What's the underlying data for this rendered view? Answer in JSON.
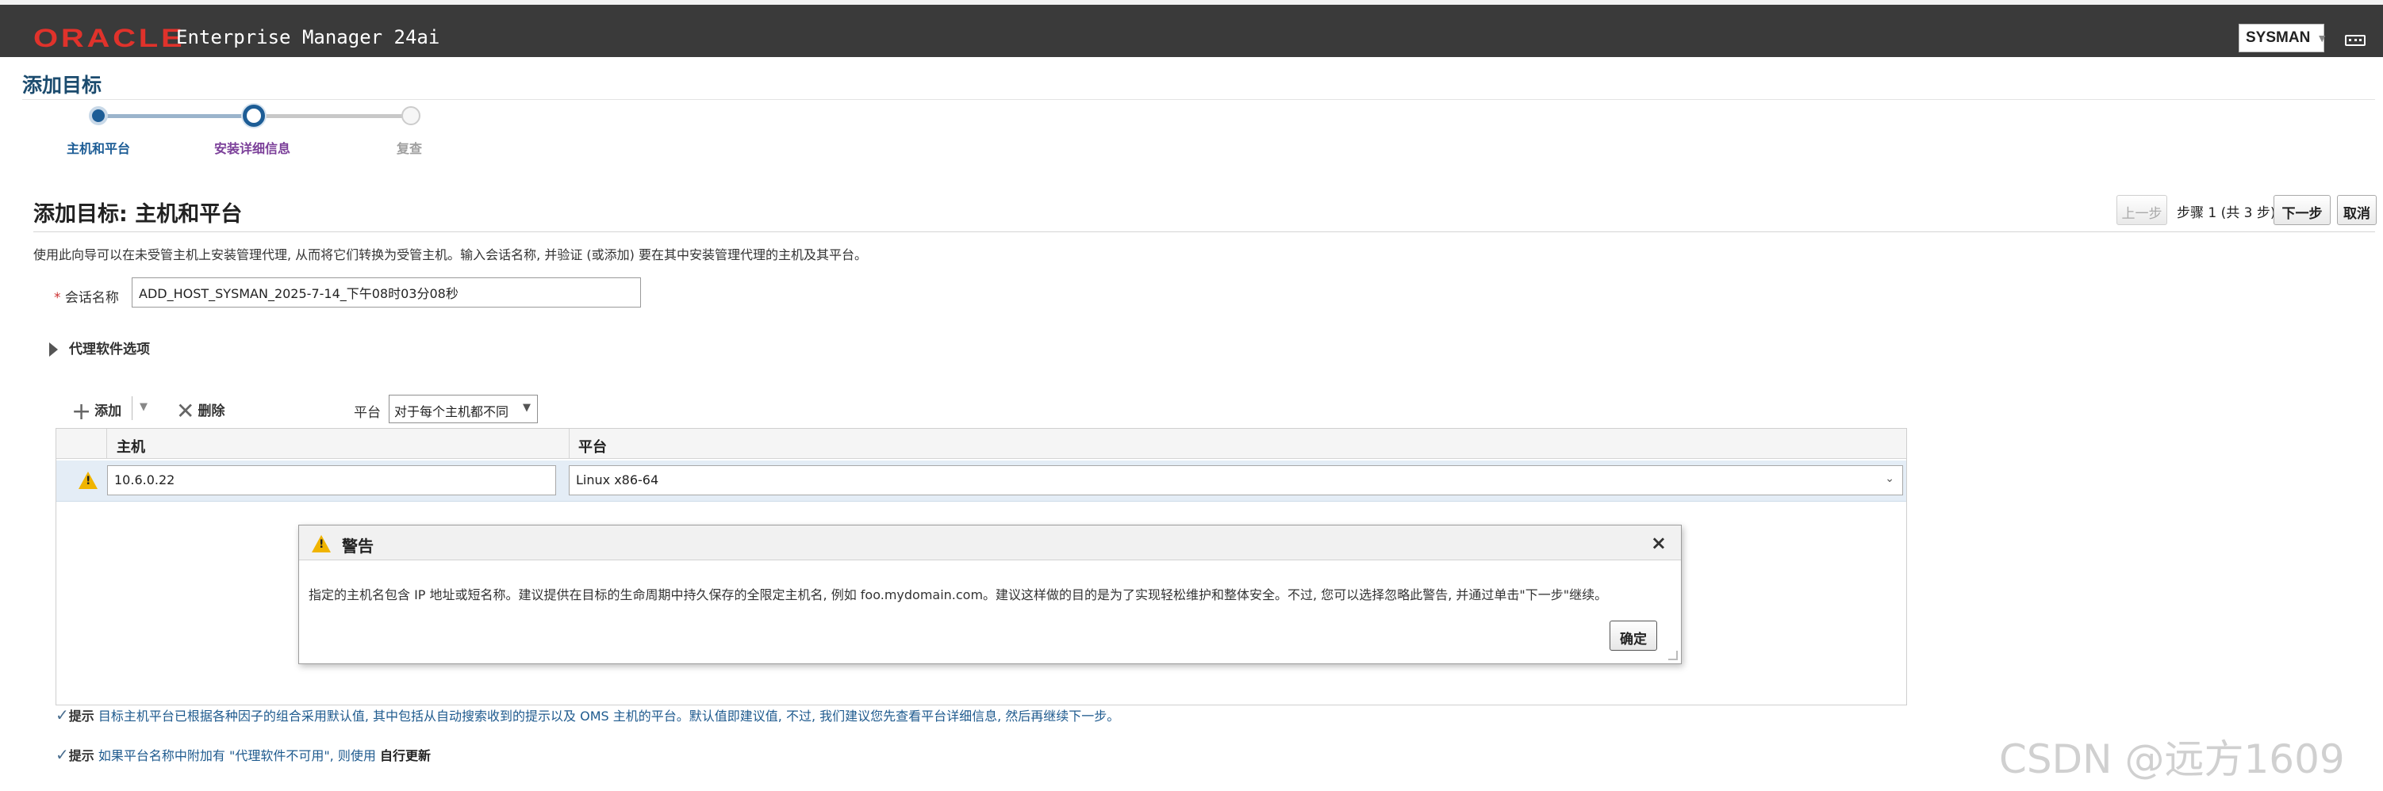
{
  "header": {
    "logo": "ORACLE",
    "product": "Enterprise Manager 24ai",
    "user": "SYSMAN",
    "menu_icon": "hamburger-icon"
  },
  "page": {
    "title": "添加目标"
  },
  "train": {
    "steps": [
      {
        "label": "主机和平台",
        "state": "done",
        "color": "#1d5d96"
      },
      {
        "label": "安装详细信息",
        "state": "current",
        "color": "#7b3f99"
      },
      {
        "label": "复查",
        "state": "pending",
        "color": "#a0a0a0"
      }
    ]
  },
  "section": {
    "title": "添加目标: 主机和平台",
    "back_label": "上一步",
    "step_info": "步骤 1 (共 3 步)",
    "next_label": "下一步",
    "cancel_label": "取消",
    "intro": "使用此向导可以在未受管主机上安装管理代理, 从而将它们转换为受管主机。输入会话名称, 并验证 (或添加) 要在其中安装管理代理的主机及其平台。"
  },
  "form": {
    "required_mark": "*",
    "session_label": "会话名称",
    "session_value": "ADD_HOST_SYSMAN_2025-7-14_下午08时03分08秒",
    "agent_options_label": "代理软件选项"
  },
  "toolbar": {
    "add_label": "添加",
    "delete_label": "删除",
    "platform_label": "平台",
    "platform_value": "对于每个主机都不同"
  },
  "table": {
    "columns": [
      "主机",
      "平台"
    ],
    "rows": [
      {
        "host": "10.6.0.22",
        "platform": "Linux x86-64",
        "status_icon": "warning-icon"
      }
    ]
  },
  "dialog": {
    "title": "警告",
    "message": "指定的主机名包含 IP 地址或短名称。建议提供在目标的生命周期中持久保存的全限定主机名, 例如 foo.mydomain.com。建议这样做的目的是为了实现轻松维护和整体安全。不过, 您可以选择忽略此警告, 并通过单击\"下一步\"继续。",
    "ok_label": "确定",
    "close_symbol": "×"
  },
  "tips": [
    {
      "label": "提示",
      "text": "目标主机平台已根据各种因子的组合采用默认值, 其中包括从自动搜索收到的提示以及 OMS 主机的平台。默认值即建议值, 不过, 我们建议您先查看平台详细信息, 然后再继续下一步。"
    },
    {
      "label": "提示",
      "text": "如果平台名称中附加有 \"代理软件不可用\", 则使用",
      "link": "自行更新"
    }
  ],
  "watermark": "CSDN @远方1609"
}
